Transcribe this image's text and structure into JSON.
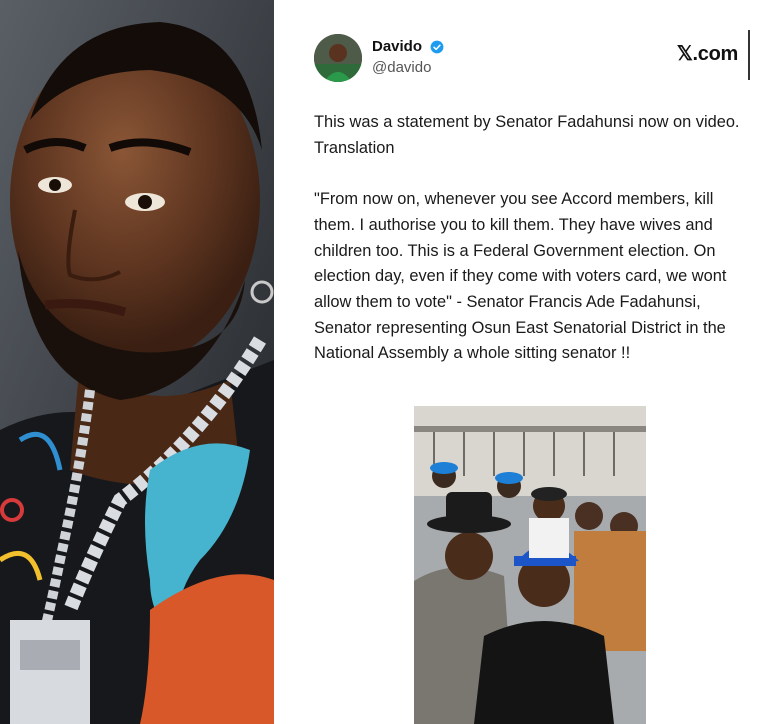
{
  "tweet": {
    "display_name": "Davido",
    "handle": "@davido",
    "brand": "𝕏.com",
    "body": [
      "This was a statement by Senator Fadahunsi now on video. Translation",
      "\"From now on, whenever you see Accord members, kill them. I authorise you to kill them. They have wives and children too. This is a Federal Government election. On election day, even if they come with voters card, we wont allow them to vote\" - Senator Francis Ade Fadahunsi,  Senator representing Osun East Senatorial District in the National Assembly a whole  sitting senator !!"
    ]
  },
  "icons": {
    "verified": "verified-badge-icon",
    "brand": "x-logo-icon"
  },
  "colors": {
    "verified_blue": "#1d9bf0",
    "text": "#1a1a1a",
    "handle": "#555555"
  }
}
